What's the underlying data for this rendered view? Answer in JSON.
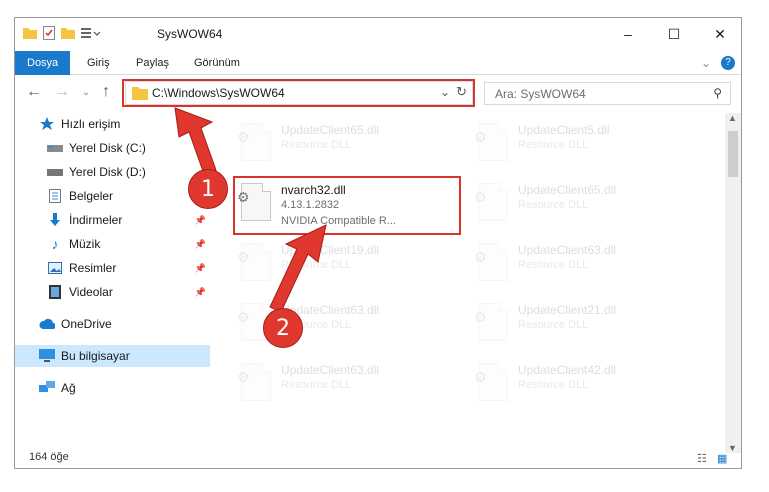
{
  "window": {
    "title": "SysWOW64"
  },
  "controls": {
    "minimize": "–",
    "maximize": "☐",
    "close": "✕",
    "help": "?"
  },
  "ribbon": {
    "tabs": [
      "Dosya",
      "Giriş",
      "Paylaş",
      "Görünüm"
    ]
  },
  "address": {
    "path": "C:\\Windows\\SysWOW64"
  },
  "search": {
    "placeholder": "Ara: SysWOW64"
  },
  "nav": {
    "items": [
      {
        "label": "Hızlı erişim",
        "icon": "star-icon"
      },
      {
        "label": "Yerel Disk (C:)",
        "icon": "drive-icon"
      },
      {
        "label": "Yerel Disk (D:)",
        "icon": "drive-icon"
      },
      {
        "label": "Belgeler",
        "icon": "document-icon"
      },
      {
        "label": "İndirmeler",
        "icon": "download-icon"
      },
      {
        "label": "Müzik",
        "icon": "music-icon"
      },
      {
        "label": "Resimler",
        "icon": "pictures-icon"
      },
      {
        "label": "Videolar",
        "icon": "video-icon"
      },
      {
        "label": "OneDrive",
        "icon": "cloud-icon"
      },
      {
        "label": "Bu bilgisayar",
        "icon": "computer-icon"
      },
      {
        "label": "Ağ",
        "icon": "network-icon"
      }
    ]
  },
  "files": {
    "left": [
      {
        "name": "UpdateClient65.dll",
        "desc": "Resource DLL"
      },
      {
        "name": "nvarch32.dll",
        "version": "4.13.1.2832",
        "desc": "NVIDIA Compatible R..."
      },
      {
        "name": "UpdateClient19.dll",
        "desc": "Resource DLL"
      },
      {
        "name": "UpdateClient63.dll",
        "desc": "Resource DLL"
      },
      {
        "name": "UpdateClient63.dll",
        "desc": "Resource DLL"
      }
    ],
    "right": [
      {
        "name": "UpdateClient5.dll",
        "desc": "Resource DLL"
      },
      {
        "name": "UpdateClient65.dll",
        "desc": "Resource DLL"
      },
      {
        "name": "UpdateClient63.dll",
        "desc": "Resource DLL"
      },
      {
        "name": "UpdateClient21.dll",
        "desc": "Resource DLL"
      },
      {
        "name": "UpdateClient42.dll",
        "desc": "Resource DLL"
      }
    ]
  },
  "status": {
    "count": "164 öğe"
  },
  "annotations": {
    "one": "1",
    "two": "2"
  },
  "colors": {
    "accent": "#1979ca",
    "highlight": "#d9342b",
    "selected": "#cce8ff"
  }
}
